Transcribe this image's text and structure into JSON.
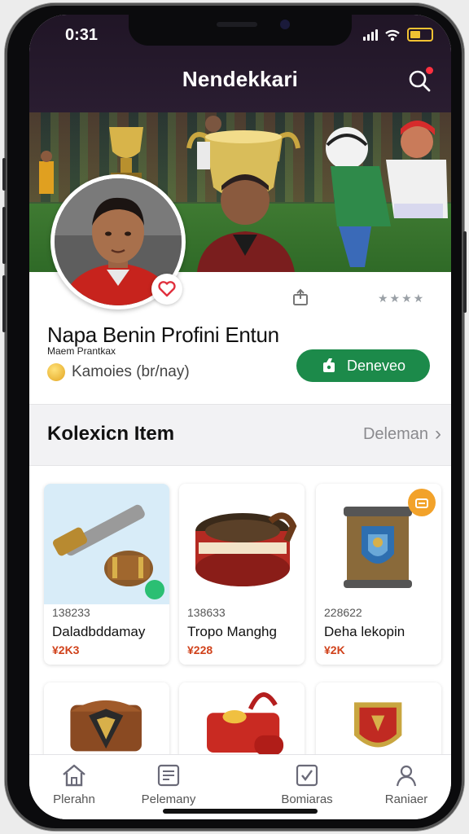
{
  "status_bar": {
    "time": "0:31"
  },
  "app_bar": {
    "title": "Nendekkari"
  },
  "profile": {
    "name": "Napa Benin Profini Entun",
    "subtitle": "Maem Prantkax",
    "coins_text": "Kamoies (br/nay)",
    "rating_text": "★★★★",
    "follow_label": "Deneveo"
  },
  "collection": {
    "title": "Kolexicn Item",
    "see_all": "Deleman",
    "items": [
      {
        "id": "138233",
        "name": "Daladbddamay",
        "price": "¥2K3"
      },
      {
        "id": "138633",
        "name": "Tropo Manghg",
        "price": "¥228"
      },
      {
        "id": "228622",
        "name": "Deha lekopin",
        "price": "¥2K"
      }
    ]
  },
  "bottom_nav": {
    "items": [
      {
        "label": "Plerahn",
        "icon": "home-icon"
      },
      {
        "label": "Pelemany",
        "icon": "list-icon"
      },
      {
        "label": "Bomiaras",
        "icon": "check-box-icon"
      },
      {
        "label": "Raniaer",
        "icon": "profile-icon"
      }
    ]
  },
  "colors": {
    "app_bar": "#201526",
    "follow_button": "#1c8a4a",
    "price": "#d0421b",
    "notification_dot": "#ff3040"
  }
}
